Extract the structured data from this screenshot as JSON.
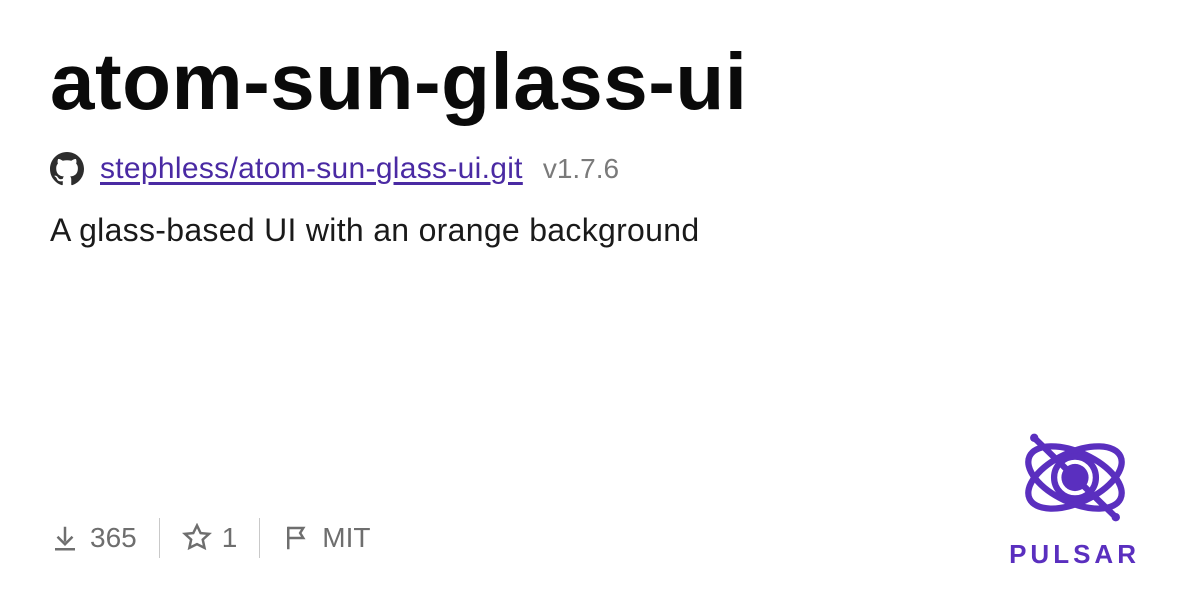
{
  "package": {
    "name": "atom-sun-glass-ui",
    "repo": "stephless/atom-sun-glass-ui.git",
    "version": "v1.7.6",
    "description": "A glass-based UI with an orange background"
  },
  "stats": {
    "downloads": "365",
    "stars": "1",
    "license": "MIT"
  },
  "brand": {
    "name": "PULSAR"
  }
}
